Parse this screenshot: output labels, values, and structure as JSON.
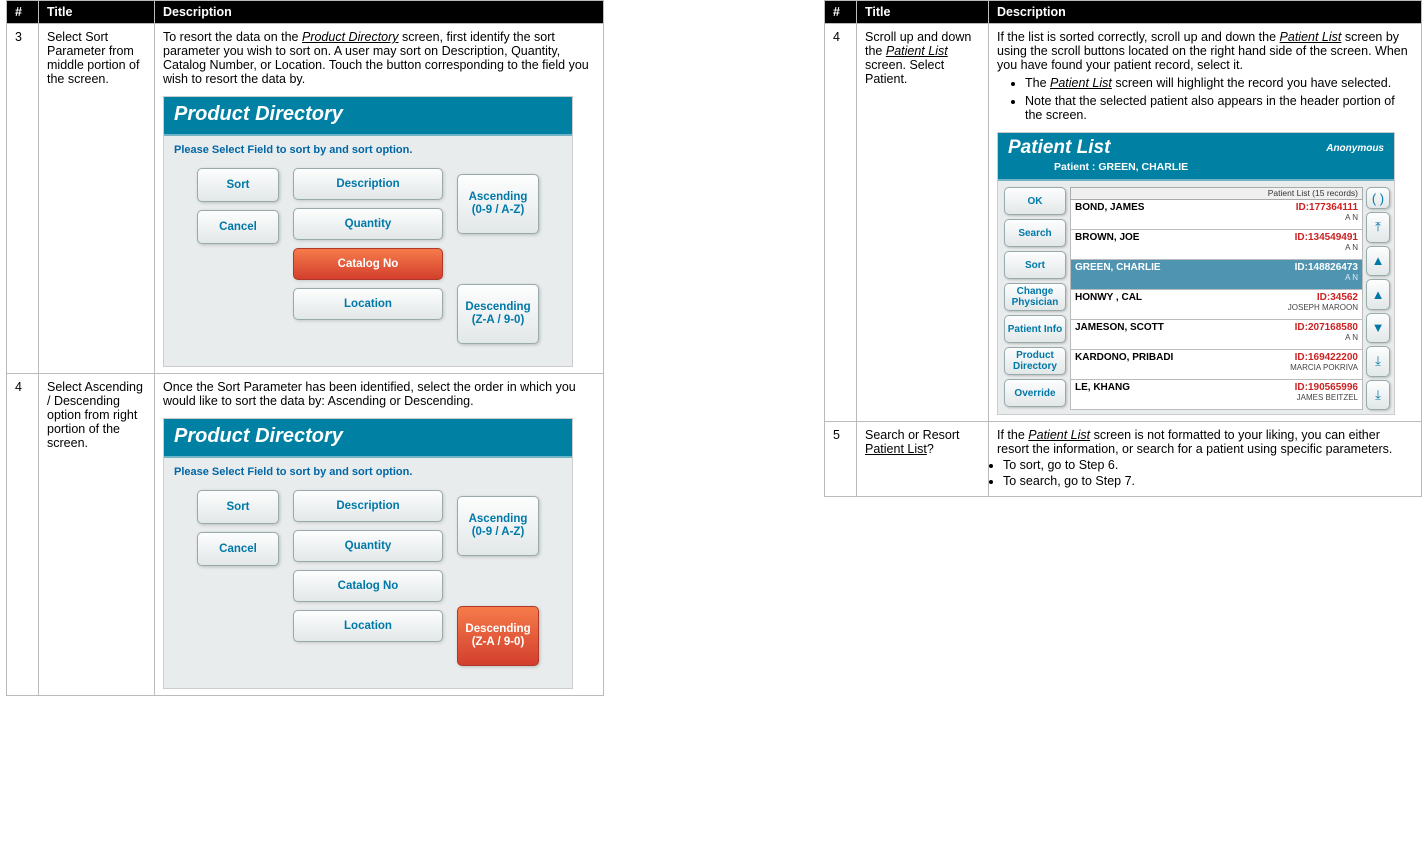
{
  "headers": {
    "num": "#",
    "title": "Title",
    "desc": "Description"
  },
  "left": {
    "r1": {
      "num": "3",
      "title": "Select Sort Parameter from middle portion of the screen.",
      "desc_a": "To resort the data on the ",
      "desc_link": "Product Directory",
      "desc_b": " screen, first identify the sort parameter you wish to sort on.  A user may sort on Description, Quantity, Catalog Number, or Location.  Touch the button corresponding to the field you wish to resort the data by."
    },
    "r2": {
      "num": "4",
      "title": "Select Ascending / Descending option from right portion of the screen.",
      "desc": "Once the Sort Parameter has been identified, select the order in which you would like to sort the data by: Ascending or Descending."
    },
    "shot": {
      "title": "Product Directory",
      "sub": "Please Select Field to sort by and sort option.",
      "left": {
        "sort": "Sort",
        "cancel": "Cancel"
      },
      "mid": {
        "desc": "Description",
        "qty": "Quantity",
        "cat": "Catalog No",
        "loc": "Location"
      },
      "right": {
        "asc": "Ascending\n(0-9 / A-Z)",
        "desc": "Descending\n(Z-A / 9-0)"
      }
    }
  },
  "right": {
    "r1": {
      "num": "4",
      "title_a": "Scroll up and down the ",
      "title_link": "Patient List",
      "title_b": " screen. Select Patient.",
      "desc_a": "If the list is sorted correctly, scroll up and down the ",
      "desc_link": "Patient List",
      "desc_b": " screen by using the scroll buttons located on the right hand side of the screen.  When you have found your patient record, select it.",
      "b1a": "The ",
      "b1link": "Patient List",
      "b1b": " screen will highlight the record you have selected.",
      "b2": "Note that the selected patient also appears in the header portion of the screen."
    },
    "r2": {
      "num": "5",
      "title_a": "Search or Resort ",
      "title_link": "Patient List",
      "title_b": "?",
      "desc_a": "If the ",
      "desc_link": "Patient List",
      "desc_b": " screen is not formatted to your liking, you can either resort the information, or search for a patient using specific parameters.",
      "b1": "To sort, go to Step 6.",
      "b2": "To search, go to Step 7."
    },
    "pshot": {
      "title": "Patient List",
      "anon": "Anonymous",
      "sub": "Patient : GREEN, CHARLIE",
      "list_hdr": "Patient List (15 records)",
      "buttons": [
        "OK",
        "Search",
        "Sort",
        "Change Physician",
        "Patient Info",
        "Product Directory",
        "Override"
      ],
      "rows": [
        {
          "name": "BOND, JAMES",
          "id": "ID:177364111",
          "sub": "A N"
        },
        {
          "name": "BROWN, JOE",
          "id": "ID:134549491",
          "sub": "A N"
        },
        {
          "name": "GREEN, CHARLIE",
          "id": "ID:148826473",
          "sub": "A N",
          "sel": true
        },
        {
          "name": "HONWY , CAL",
          "id": "ID:34562",
          "sub": "JOSEPH MAROON"
        },
        {
          "name": "JAMESON, SCOTT",
          "id": "ID:207168580",
          "sub": "A N"
        },
        {
          "name": "KARDONO, PRIBADI",
          "id": "ID:169422200",
          "sub": "MARCIA POKRIVA"
        },
        {
          "name": "LE, KHANG",
          "id": "ID:190565996",
          "sub": "JAMES BEITZEL"
        }
      ],
      "scroll": [
        "( )",
        "⤒",
        "▲",
        "▲",
        "▼",
        "⤓",
        "⤓"
      ]
    }
  }
}
